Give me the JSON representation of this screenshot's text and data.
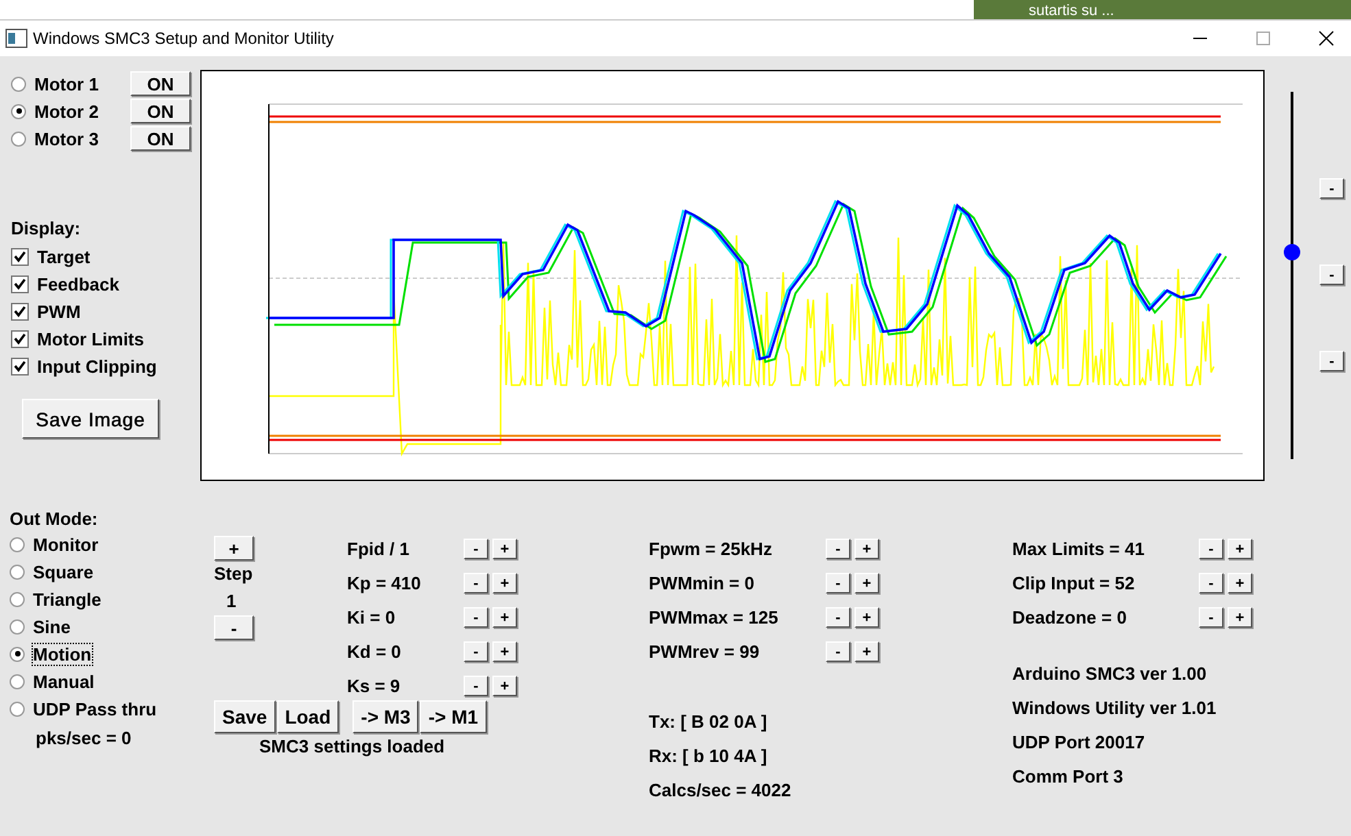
{
  "background": {
    "window_text": "sutartis su ..."
  },
  "window": {
    "title": "Windows SMC3 Setup and Monitor Utility"
  },
  "motors": [
    {
      "label": "Motor 1",
      "selected": false,
      "button": "ON"
    },
    {
      "label": "Motor 2",
      "selected": true,
      "button": "ON"
    },
    {
      "label": "Motor 3",
      "selected": false,
      "button": "ON"
    }
  ],
  "display": {
    "label": "Display:",
    "options": [
      {
        "label": "Target",
        "checked": true
      },
      {
        "label": "Feedback",
        "checked": true
      },
      {
        "label": "PWM",
        "checked": true
      },
      {
        "label": "Motor Limits",
        "checked": true
      },
      {
        "label": "Input Clipping",
        "checked": true
      }
    ]
  },
  "save_image_button": "Save Image",
  "position_slider": {
    "level": 0.57
  },
  "side_buttons": [
    "-",
    "-",
    "-"
  ],
  "out_mode": {
    "label": "Out Mode:",
    "options": [
      {
        "label": "Monitor",
        "selected": false
      },
      {
        "label": "Square",
        "selected": false
      },
      {
        "label": "Triangle",
        "selected": false
      },
      {
        "label": "Sine",
        "selected": false
      },
      {
        "label": "Motion",
        "selected": true
      },
      {
        "label": "Manual",
        "selected": false
      },
      {
        "label": "UDP Pass thru",
        "selected": false
      }
    ],
    "packet_rate": "pks/sec = 0"
  },
  "step": {
    "increase": "+",
    "label": "Step",
    "value": "1",
    "decrease": "-"
  },
  "pid_params": [
    {
      "label": "Fpid / 1",
      "minus": "-",
      "plus": "+"
    },
    {
      "label": "Kp = 410",
      "minus": "-",
      "plus": "+"
    },
    {
      "label": "Ki = 0",
      "minus": "-",
      "plus": "+"
    },
    {
      "label": "Kd = 0",
      "minus": "-",
      "plus": "+"
    },
    {
      "label": "Ks = 9",
      "minus": "-",
      "plus": "+"
    }
  ],
  "pwm_params": [
    {
      "label": "Fpwm = 25kHz",
      "minus": "-",
      "plus": "+"
    },
    {
      "label": "PWMmin = 0",
      "minus": "-",
      "plus": "+"
    },
    {
      "label": "PWMmax = 125",
      "minus": "-",
      "plus": "+"
    },
    {
      "label": "PWMrev = 99",
      "minus": "-",
      "plus": "+"
    }
  ],
  "limit_params": [
    {
      "label": "Max Limits = 41",
      "minus": "-",
      "plus": "+"
    },
    {
      "label": "Clip Input = 52",
      "minus": "-",
      "plus": "+"
    },
    {
      "label": "Deadzone = 0",
      "minus": "-",
      "plus": "+"
    }
  ],
  "file_buttons": [
    "Save",
    "Load"
  ],
  "copy_buttons": [
    "-> M3",
    "-> M1"
  ],
  "status": "SMC3 settings loaded",
  "comms": [
    "Tx: [ B 02 0A ]",
    "Rx: [ b 10 4A ]",
    "Calcs/sec = 4022"
  ],
  "info": [
    "Arduino SMC3 ver 1.00",
    "Windows Utility ver 1.01",
    "UDP Port 20017",
    "Comm Port 3"
  ]
}
